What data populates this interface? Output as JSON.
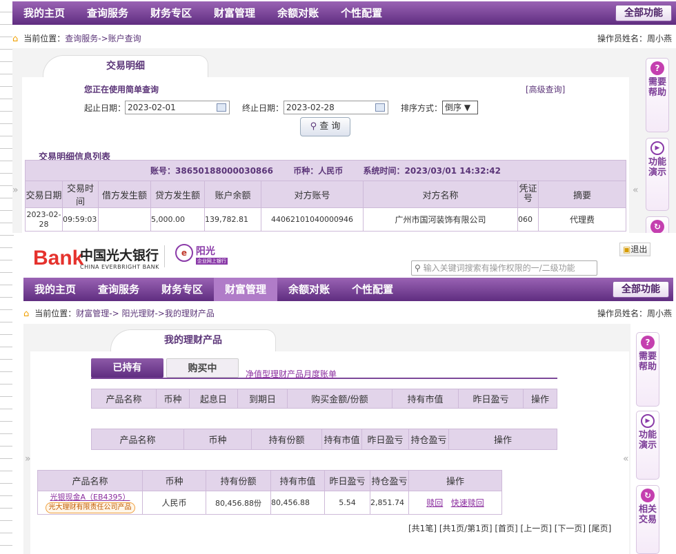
{
  "nav": {
    "items": [
      "我的主页",
      "查询服务",
      "财务专区",
      "财富管理",
      "余额对账",
      "个性配置"
    ],
    "all_functions": "全部功能",
    "active_index_2": 3
  },
  "shot1": {
    "crumb_label": "当前位置：",
    "crumb_path": "查询服务->账户查询",
    "operator": "操作员姓名：周小燕",
    "tab_title": "交易明细",
    "simple_query_note": "您正在使用简单查询",
    "advanced_query": "[高级查询]",
    "start_label": "起止日期：",
    "start_value": "2023-02-01",
    "end_label": "终止日期：",
    "end_value": "2023-02-28",
    "sort_label": "排序方式：",
    "sort_value": "倒序",
    "query_button": "查 询",
    "list_title": "交易明细信息列表",
    "account_label": "账号：",
    "account_value": "38650188000030866",
    "currency_label": "币种：",
    "currency_value": "人民币",
    "systime_label": "系统时间：",
    "systime_value": "2023/03/01 14:32:42",
    "columns": [
      "交易日期",
      "交易时间",
      "借方发生额",
      "贷方发生额",
      "账户余额",
      "对方账号",
      "对方名称",
      "凭证号",
      "摘要"
    ],
    "rows": [
      [
        "2023-02-28",
        "09:59:03",
        "",
        "5,000.00",
        "139,782.81",
        "44062101040000946",
        "广州市国河装饰有限公司",
        "060",
        "代理费"
      ]
    ]
  },
  "help_sidebar": {
    "help": "需要帮助",
    "demo": "功能演示",
    "related": "相关交易"
  },
  "shot2": {
    "brand_name": "中国光大银行",
    "brand_en": "CHINA EVERBRIGHT BANK",
    "brand_mark": "Bank",
    "logo2_text": "阳光",
    "logo2_sub": "企业网上银行",
    "logout": "退出",
    "search_placeholder": "输入关键词搜索有操作权限的一/二级功能",
    "crumb_label": "当前位置：",
    "crumb_path": "财富管理->  阳光理财->我的理财产品",
    "operator": "操作员姓名：周小燕",
    "tab_title": "我的理财产品",
    "tab_held": "已持有",
    "tab_buying": "购买中",
    "monthly_link": "净值型理财产品月度账单",
    "table1_columns": [
      "产品名称",
      "币种",
      "起息日",
      "到期日",
      "购买金额/份额",
      "持有市值",
      "昨日盈亏",
      "操作"
    ],
    "table2_columns": [
      "产品名称",
      "币种",
      "持有份额",
      "持有市值",
      "昨日盈亏",
      "持仓盈亏",
      "操作"
    ],
    "table3_columns": [
      "产品名称",
      "币种",
      "持有份额",
      "持有市值",
      "昨日盈亏",
      "持仓盈亏",
      "操作"
    ],
    "product_name": "光银现金A（EB4395）",
    "product_issuer": "光大理财有限责任公司产品",
    "product_currency": "人民币",
    "product_shares": "80,456.88份",
    "product_value": "80,456.88",
    "product_yesterday": "5.54",
    "product_position": "2,851.74",
    "op_redeem": "赎回",
    "op_fast_redeem": "快速赎回",
    "pagination": [
      "[共1笔]",
      "[共1页/第1页]",
      "[首页]",
      "[上一页]",
      "[下一页]",
      "[尾页]"
    ]
  },
  "colors": {
    "nav_top": "#9a63b4",
    "nav_bottom": "#5f2d80",
    "accent": "#5b3578",
    "header_cell": "#e2d4ea"
  }
}
